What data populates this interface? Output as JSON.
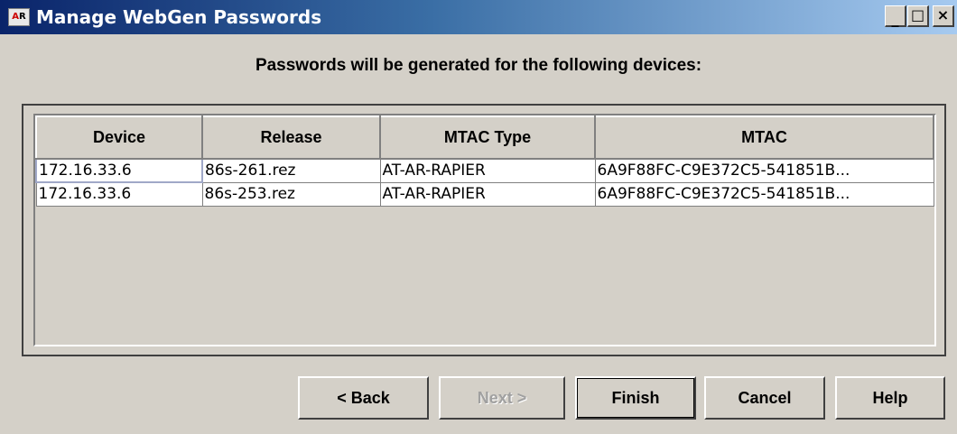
{
  "window": {
    "title": "Manage WebGen Passwords",
    "icon": "app-logo-icon",
    "controls": {
      "minimize": "_",
      "maximize": "□",
      "close": "×"
    }
  },
  "heading": "Passwords will be generated for the following devices:",
  "table": {
    "columns": [
      "Device",
      "Release",
      "MTAC Type",
      "MTAC"
    ],
    "rows": [
      [
        "172.16.33.6",
        "86s-261.rez",
        "AT-AR-RAPIER",
        "6A9F88FC-C9E372C5-541851B..."
      ],
      [
        "172.16.33.6",
        "86s-253.rez",
        "AT-AR-RAPIER",
        "6A9F88FC-C9E372C5-541851B..."
      ]
    ]
  },
  "buttons": {
    "back": "< Back",
    "next": "Next >",
    "finish": "Finish",
    "cancel": "Cancel",
    "help": "Help"
  },
  "colors": {
    "title_gradient_start": "#0a246a",
    "title_gradient_end": "#a6caf0",
    "dialog_bg": "#d4d0c8"
  }
}
